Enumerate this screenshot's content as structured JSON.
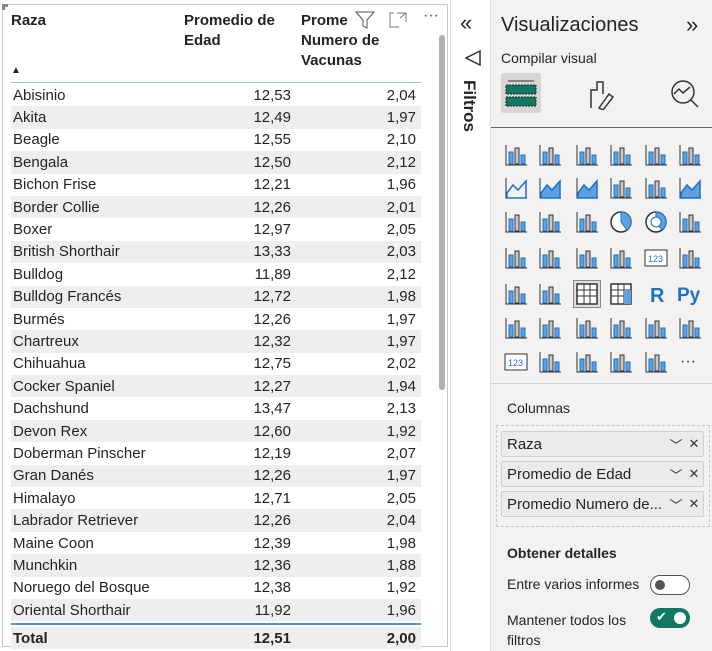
{
  "table": {
    "headers": {
      "raza": "Raza",
      "edad": "Promedio de Edad",
      "vacunas_line1": "Prome",
      "vacunas_rest": "Numero de Vacunas"
    },
    "sort_indicator": "▲",
    "rows": [
      [
        "Abisinio",
        "12,53",
        "2,04"
      ],
      [
        "Akita",
        "12,49",
        "1,97"
      ],
      [
        "Beagle",
        "12,55",
        "2,10"
      ],
      [
        "Bengala",
        "12,50",
        "2,12"
      ],
      [
        "Bichon Frise",
        "12,21",
        "1,96"
      ],
      [
        "Border Collie",
        "12,26",
        "2,01"
      ],
      [
        "Boxer",
        "12,97",
        "2,05"
      ],
      [
        "British Shorthair",
        "13,33",
        "2,03"
      ],
      [
        "Bulldog",
        "11,89",
        "2,12"
      ],
      [
        "Bulldog Francés",
        "12,72",
        "1,98"
      ],
      [
        "Burmés",
        "12,26",
        "1,97"
      ],
      [
        "Chartreux",
        "12,32",
        "1,97"
      ],
      [
        "Chihuahua",
        "12,75",
        "2,02"
      ],
      [
        "Cocker Spaniel",
        "12,27",
        "1,94"
      ],
      [
        "Dachshund",
        "13,47",
        "2,13"
      ],
      [
        "Devon Rex",
        "12,60",
        "1,92"
      ],
      [
        "Doberman Pinscher",
        "12,19",
        "2,07"
      ],
      [
        "Gran Danés",
        "12,26",
        "1,97"
      ],
      [
        "Himalayo",
        "12,71",
        "2,05"
      ],
      [
        "Labrador Retriever",
        "12,26",
        "2,04"
      ],
      [
        "Maine Coon",
        "12,39",
        "1,98"
      ],
      [
        "Munchkin",
        "12,36",
        "1,88"
      ],
      [
        "Noruego del Bosque",
        "12,38",
        "1,92"
      ],
      [
        "Oriental Shorthair",
        "11,92",
        "1,96"
      ]
    ],
    "total": [
      "Total",
      "12,51",
      "2,00"
    ],
    "more_label": "···"
  },
  "filters": {
    "label": "Filtros",
    "collapse": "«"
  },
  "viz": {
    "title": "Visualizaciones",
    "expand": "»",
    "build_label": "Compilar visual",
    "icons": [
      "stacked-bar",
      "stacked-column",
      "clustered-bar",
      "clustered-column",
      "100-stacked-bar",
      "100-stacked-column",
      "line",
      "area",
      "stacked-area",
      "line-clustered-column",
      "line-stacked-column",
      "ribbon",
      "waterfall",
      "funnel",
      "scatter",
      "pie",
      "donut",
      "treemap",
      "map",
      "filled-map",
      "azure-map",
      "gauge",
      "card",
      "multi-row-card",
      "kpi",
      "slicer",
      "table",
      "matrix",
      "r-visual",
      "python-visual",
      "key-influencers",
      "decomposition-tree",
      "qa",
      "smart-narrative",
      "metrics",
      "paginated-report",
      "power-apps-card",
      "power-apps-slicer",
      "arcgis-map",
      "power-apps",
      "power-automate",
      "more"
    ],
    "selected_icon": "table",
    "columns_label": "Columnas",
    "fields": [
      "Raza",
      "Promedio de Edad",
      "Promedio Numero de..."
    ],
    "drill_label": "Obtener detalles",
    "cross_report": {
      "label": "Entre varios informes",
      "on": false
    },
    "keep_filters": {
      "label": "Mantener todos los filtros",
      "on": true
    },
    "accent": "#117865"
  }
}
